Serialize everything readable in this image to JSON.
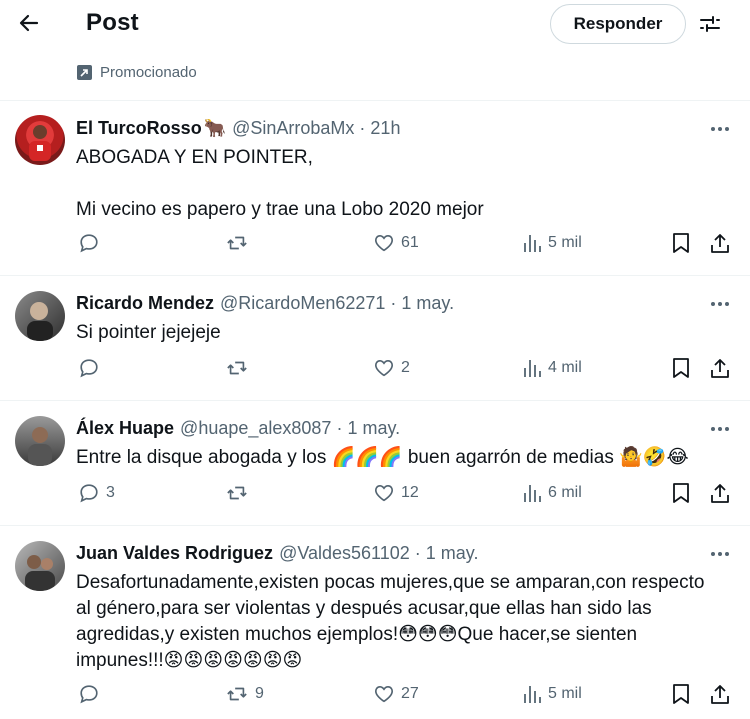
{
  "header": {
    "title": "Post",
    "reply_label": "Responder"
  },
  "promo": {
    "label": "Promocionado"
  },
  "replies": [
    {
      "name": "El TurcoRosso",
      "name_emoji": "🐂",
      "handle": "@SinArrobaMx",
      "time": "21h",
      "lines": [
        "ABOGADA Y EN POINTER,",
        "",
        "Mi vecino es papero y trae una Lobo 2020 mejor"
      ],
      "stats": {
        "replies": "",
        "reposts": "",
        "likes": "61",
        "views": "5 mil"
      }
    },
    {
      "name": "Ricardo Mendez",
      "name_emoji": "",
      "handle": "@RicardoMen62271",
      "time": "1 may.",
      "lines": [
        "Si pointer jejejeje"
      ],
      "stats": {
        "replies": "",
        "reposts": "",
        "likes": "2",
        "views": "4 mil"
      }
    },
    {
      "name": "Álex Huape",
      "name_emoji": "",
      "handle": "@huape_alex8087",
      "time": "1 may.",
      "lines": [
        "Entre la disque abogada y los 🌈🌈🌈 buen agarrón de medias 🤷🤣😂"
      ],
      "stats": {
        "replies": "3",
        "reposts": "",
        "likes": "12",
        "views": "6 mil"
      }
    },
    {
      "name": "Juan Valdes Rodriguez",
      "name_emoji": "",
      "handle": "@Valdes561102",
      "time": "1 may.",
      "lines": [
        "Desafortunadamente,existen pocas mujeres,que se amparan,con respecto",
        "al género,para ser violentas y después acusar,que ellas han sido las",
        "agredidas,y existen muchos ejemplos!😳😳😳Que hacer,se sienten",
        "impunes!!!😡😡😡😡😡😡😡"
      ],
      "stats": {
        "replies": "",
        "reposts": "9",
        "likes": "27",
        "views": "5 mil"
      }
    }
  ],
  "colors": {
    "text": "#0f1419",
    "muted": "#536471",
    "divider": "#eff3f4"
  },
  "icons": [
    "back-arrow-icon",
    "filter-icon",
    "promoted-icon",
    "more-icon",
    "reply-icon",
    "repost-icon",
    "like-icon",
    "views-icon",
    "bookmark-icon",
    "share-icon"
  ]
}
